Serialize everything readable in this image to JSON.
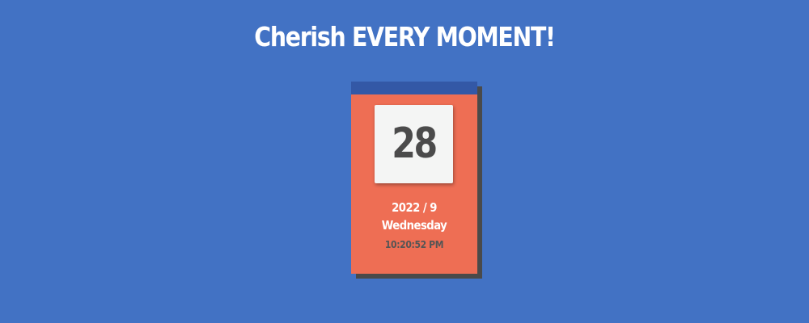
{
  "header": {
    "title": "Cherish EVERY MOMENT!"
  },
  "calendar": {
    "day": "28",
    "year_month": "2022 / 9",
    "weekday": "Wednesday",
    "time": "10:20:52 PM"
  },
  "colors": {
    "background": "#4272c4",
    "card": "#ee6e54",
    "card_band": "#3358a6",
    "card_shadow": "#4a4a4a",
    "tile": "#f4f5f4",
    "day_text": "#4b4b4b",
    "time_text": "#555555"
  }
}
